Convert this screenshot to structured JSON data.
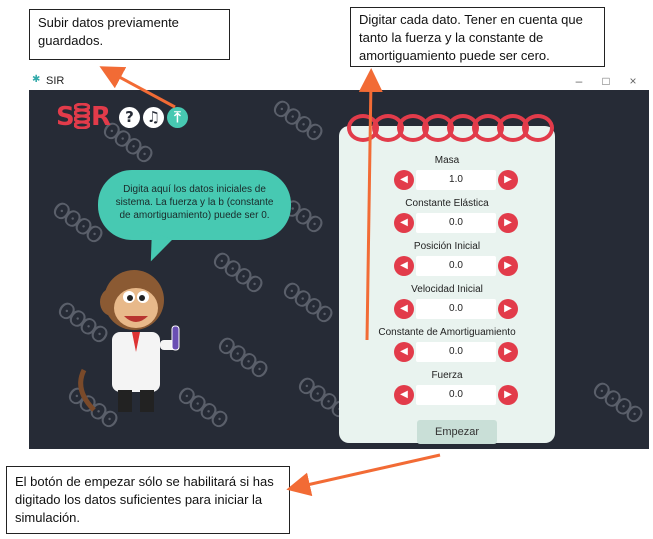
{
  "callouts": {
    "upload": "Subir datos previamente guardados.",
    "input": "Digitar cada dato. Tener en cuenta que tanto la fuerza y la constante de amortiguamiento puede ser cero.",
    "start": "El botón de empezar sólo se habilitará si has digitado los datos suficientes para iniciar la simulación."
  },
  "window": {
    "title": "SIR",
    "controls": [
      "–",
      "□",
      "×"
    ]
  },
  "logo": {
    "letters": [
      "S",
      "R"
    ]
  },
  "toolbar": {
    "help": "?",
    "music": "♫",
    "upload": "⤒"
  },
  "bubble": {
    "text": "Digita aquí los datos iniciales de sistema. La fuerza y la b (constante de amortiguamiento) puede ser 0."
  },
  "form": {
    "fields": [
      {
        "label": "Masa",
        "value": "1.0"
      },
      {
        "label": "Constante Elástica",
        "value": "0.0"
      },
      {
        "label": "Posición Inicial",
        "value": "0.0"
      },
      {
        "label": "Velocidad Inicial",
        "value": "0.0"
      },
      {
        "label": "Constante de Amortiguamiento",
        "value": "0.0"
      },
      {
        "label": "Fuerza",
        "value": "0.0"
      }
    ],
    "start_label": "Empezar"
  },
  "colors": {
    "accent": "#e23b4a",
    "background": "#262b36",
    "bubble": "#47c9b2",
    "callout_arrow": "#f26b35"
  }
}
